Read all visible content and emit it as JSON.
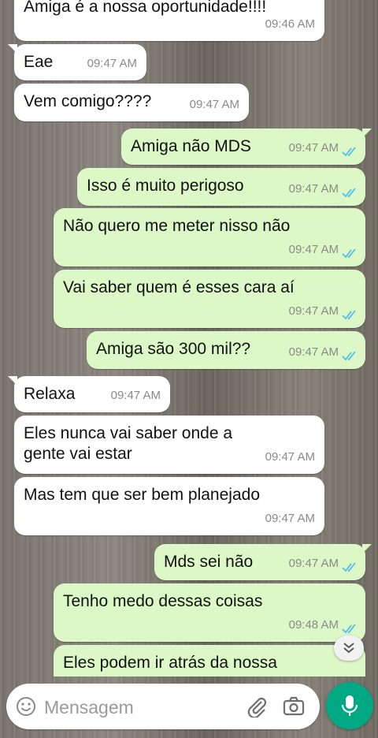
{
  "messages": [
    {
      "text": "Amiga é a nossa oportunidade!!!!",
      "time": "09:46 AM",
      "dir": "in"
    },
    {
      "text": "Eae",
      "time": "09:47 AM",
      "dir": "in"
    },
    {
      "text": "Vem comigo????",
      "time": "09:47 AM",
      "dir": "in"
    },
    {
      "text": "Amiga não MDS",
      "time": "09:47 AM",
      "dir": "out"
    },
    {
      "text": "Isso é muito perigoso",
      "time": "09:47 AM",
      "dir": "out"
    },
    {
      "text": "Não quero me meter nisso não",
      "time": "09:47 AM",
      "dir": "out"
    },
    {
      "text": "Vai saber quem é esses cara aí",
      "time": "09:47 AM",
      "dir": "out"
    },
    {
      "text": "Amiga são 300 mil??",
      "time": "09:47 AM",
      "dir": "out"
    },
    {
      "text": "Relaxa",
      "time": "09:47 AM",
      "dir": "in"
    },
    {
      "text": "Eles nunca vai saber onde a gente vai estar",
      "time": "09:47 AM",
      "dir": "in"
    },
    {
      "text": "Mas tem que ser bem planejado",
      "time": "09:47 AM",
      "dir": "in"
    },
    {
      "text": "Mds sei não",
      "time": "09:47 AM",
      "dir": "out"
    },
    {
      "text": "Tenho medo dessas coisas",
      "time": "09:48 AM",
      "dir": "out"
    },
    {
      "text": "Eles podem ir atrás da nossa",
      "time": "",
      "dir": "out"
    }
  ],
  "composer": {
    "placeholder": "Mensagem"
  },
  "icons": {
    "emoji": "emoji-icon",
    "attach": "paperclip-icon",
    "camera": "camera-icon",
    "mic": "microphone-icon",
    "scroll": "double-chevron-down-icon",
    "read": "double-check-icon"
  },
  "colors": {
    "incoming_bubble": "#ffffff",
    "outgoing_bubble": "#dcf8c6",
    "read_ticks": "#53bdeb",
    "mic_button": "#00a884",
    "timestamp": "#8a8a8a"
  }
}
